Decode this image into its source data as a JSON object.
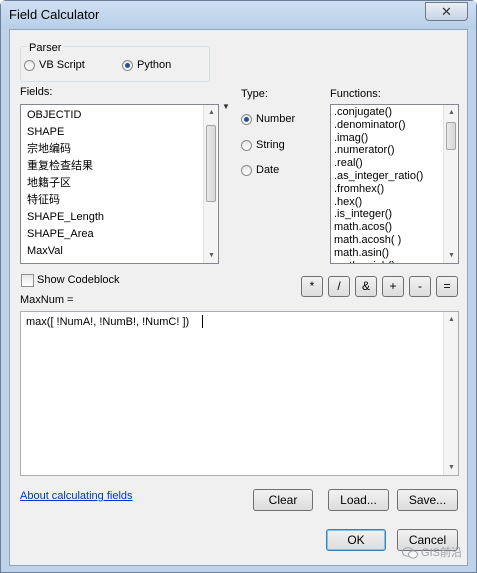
{
  "window": {
    "title": "Field Calculator",
    "close_glyph": "✕"
  },
  "parser": {
    "label": "Parser",
    "options": [
      {
        "label": "VB Script",
        "selected": false
      },
      {
        "label": "Python",
        "selected": true
      }
    ]
  },
  "fields": {
    "label": "Fields:",
    "items": [
      "OBJECTID",
      "SHAPE",
      "宗地编码",
      "重复检查结果",
      "地籍子区",
      "特征码",
      "SHAPE_Length",
      "SHAPE_Area",
      "MaxVal"
    ]
  },
  "type": {
    "label": "Type:",
    "options": [
      {
        "label": "Number",
        "selected": true
      },
      {
        "label": "String",
        "selected": false
      },
      {
        "label": "Date",
        "selected": false
      }
    ]
  },
  "functions": {
    "label": "Functions:",
    "items": [
      ".conjugate()",
      ".denominator()",
      ".imag()",
      ".numerator()",
      ".real()",
      ".as_integer_ratio()",
      ".fromhex()",
      ".hex()",
      ".is_integer()",
      "math.acos()",
      "math.acosh( )",
      "math.asin()",
      "math.asinh()"
    ]
  },
  "codeblock": {
    "label": "Show Codeblock",
    "checked": false
  },
  "operators": [
    "*",
    "/",
    "&",
    "+",
    "-",
    "="
  ],
  "expression": {
    "label": "MaxNum =",
    "value": "max([ !NumA!, !NumB!, !NumC! ])"
  },
  "footer": {
    "help_link": "About calculating fields",
    "clear": "Clear",
    "load": "Load...",
    "save": "Save...",
    "ok": "OK",
    "cancel": "Cancel"
  },
  "watermark": {
    "text": "GIS前沿"
  },
  "icons": {
    "scroll_up": "triangle-up",
    "scroll_down": "triangle-down",
    "dropdown": "triangle-down"
  }
}
